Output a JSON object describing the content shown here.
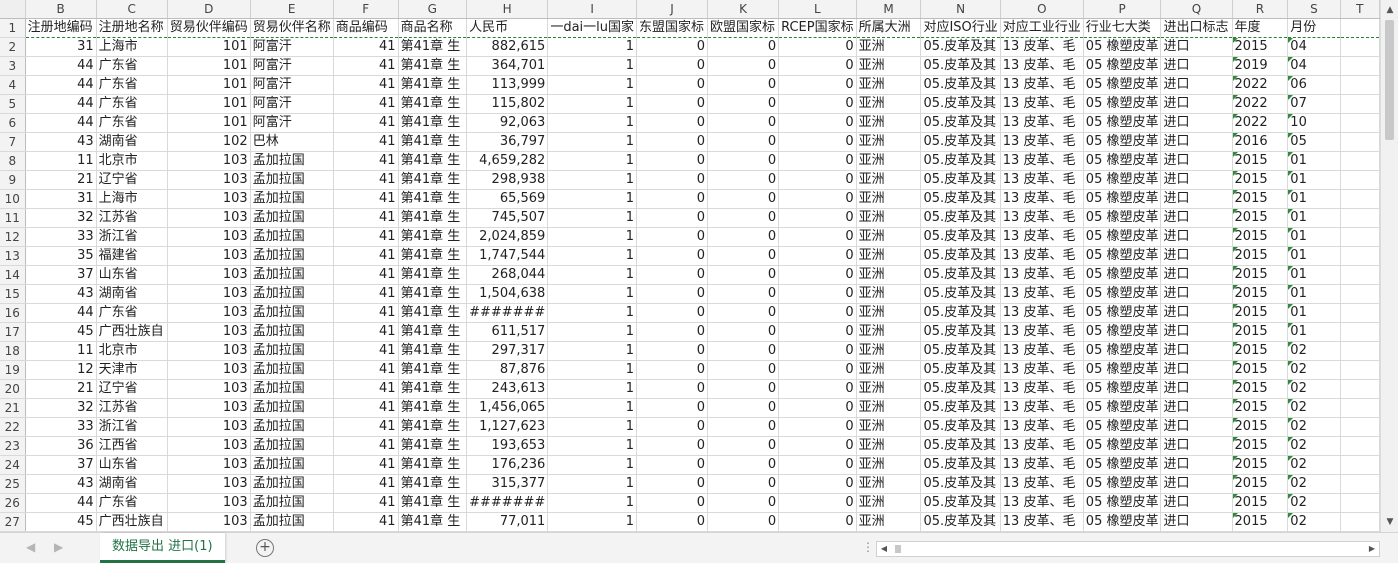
{
  "columns": [
    "B",
    "C",
    "D",
    "E",
    "F",
    "G",
    "H",
    "I",
    "J",
    "K",
    "L",
    "M",
    "N",
    "O",
    "P",
    "Q",
    "R",
    "S",
    "T"
  ],
  "header_row": {
    "number": "1",
    "cells": [
      "注册地编码",
      "注册地名称",
      "贸易伙伴编码",
      "贸易伙伴名称",
      "商品编码",
      "商品名称",
      "人民币",
      "一dai一lu国家",
      "东盟国家标",
      "欧盟国家标",
      "RCEP国家标",
      "所属大洲",
      "对应ISO行业",
      "对应工业行业",
      "行业七大类",
      "进出口标志",
      "年度",
      "月份",
      ""
    ]
  },
  "rows": [
    {
      "n": "2",
      "c": [
        "31",
        "上海市",
        "101",
        "阿富汗",
        "41",
        "第41章 生",
        "882,615",
        "1",
        "0",
        "0",
        "0",
        "亚洲",
        "05.皮革及其",
        "13 皮革、毛",
        "05 橡塑皮革",
        "进口",
        "2015",
        "04",
        ""
      ]
    },
    {
      "n": "3",
      "c": [
        "44",
        "广东省",
        "101",
        "阿富汗",
        "41",
        "第41章 生",
        "364,701",
        "1",
        "0",
        "0",
        "0",
        "亚洲",
        "05.皮革及其",
        "13 皮革、毛",
        "05 橡塑皮革",
        "进口",
        "2019",
        "04",
        ""
      ]
    },
    {
      "n": "4",
      "c": [
        "44",
        "广东省",
        "101",
        "阿富汗",
        "41",
        "第41章 生",
        "113,999",
        "1",
        "0",
        "0",
        "0",
        "亚洲",
        "05.皮革及其",
        "13 皮革、毛",
        "05 橡塑皮革",
        "进口",
        "2022",
        "06",
        ""
      ]
    },
    {
      "n": "5",
      "c": [
        "44",
        "广东省",
        "101",
        "阿富汗",
        "41",
        "第41章 生",
        "115,802",
        "1",
        "0",
        "0",
        "0",
        "亚洲",
        "05.皮革及其",
        "13 皮革、毛",
        "05 橡塑皮革",
        "进口",
        "2022",
        "07",
        ""
      ]
    },
    {
      "n": "6",
      "c": [
        "44",
        "广东省",
        "101",
        "阿富汗",
        "41",
        "第41章 生",
        "92,063",
        "1",
        "0",
        "0",
        "0",
        "亚洲",
        "05.皮革及其",
        "13 皮革、毛",
        "05 橡塑皮革",
        "进口",
        "2022",
        "10",
        ""
      ]
    },
    {
      "n": "7",
      "c": [
        "43",
        "湖南省",
        "102",
        "巴林",
        "41",
        "第41章 生",
        "36,797",
        "1",
        "0",
        "0",
        "0",
        "亚洲",
        "05.皮革及其",
        "13 皮革、毛",
        "05 橡塑皮革",
        "进口",
        "2016",
        "05",
        ""
      ]
    },
    {
      "n": "8",
      "c": [
        "11",
        "北京市",
        "103",
        "孟加拉国",
        "41",
        "第41章 生",
        "4,659,282",
        "1",
        "0",
        "0",
        "0",
        "亚洲",
        "05.皮革及其",
        "13 皮革、毛",
        "05 橡塑皮革",
        "进口",
        "2015",
        "01",
        ""
      ]
    },
    {
      "n": "9",
      "c": [
        "21",
        "辽宁省",
        "103",
        "孟加拉国",
        "41",
        "第41章 生",
        "298,938",
        "1",
        "0",
        "0",
        "0",
        "亚洲",
        "05.皮革及其",
        "13 皮革、毛",
        "05 橡塑皮革",
        "进口",
        "2015",
        "01",
        ""
      ]
    },
    {
      "n": "10",
      "c": [
        "31",
        "上海市",
        "103",
        "孟加拉国",
        "41",
        "第41章 生",
        "65,569",
        "1",
        "0",
        "0",
        "0",
        "亚洲",
        "05.皮革及其",
        "13 皮革、毛",
        "05 橡塑皮革",
        "进口",
        "2015",
        "01",
        ""
      ]
    },
    {
      "n": "11",
      "c": [
        "32",
        "江苏省",
        "103",
        "孟加拉国",
        "41",
        "第41章 生",
        "745,507",
        "1",
        "0",
        "0",
        "0",
        "亚洲",
        "05.皮革及其",
        "13 皮革、毛",
        "05 橡塑皮革",
        "进口",
        "2015",
        "01",
        ""
      ]
    },
    {
      "n": "12",
      "c": [
        "33",
        "浙江省",
        "103",
        "孟加拉国",
        "41",
        "第41章 生",
        "2,024,859",
        "1",
        "0",
        "0",
        "0",
        "亚洲",
        "05.皮革及其",
        "13 皮革、毛",
        "05 橡塑皮革",
        "进口",
        "2015",
        "01",
        ""
      ]
    },
    {
      "n": "13",
      "c": [
        "35",
        "福建省",
        "103",
        "孟加拉国",
        "41",
        "第41章 生",
        "1,747,544",
        "1",
        "0",
        "0",
        "0",
        "亚洲",
        "05.皮革及其",
        "13 皮革、毛",
        "05 橡塑皮革",
        "进口",
        "2015",
        "01",
        ""
      ]
    },
    {
      "n": "14",
      "c": [
        "37",
        "山东省",
        "103",
        "孟加拉国",
        "41",
        "第41章 生",
        "268,044",
        "1",
        "0",
        "0",
        "0",
        "亚洲",
        "05.皮革及其",
        "13 皮革、毛",
        "05 橡塑皮革",
        "进口",
        "2015",
        "01",
        ""
      ]
    },
    {
      "n": "15",
      "c": [
        "43",
        "湖南省",
        "103",
        "孟加拉国",
        "41",
        "第41章 生",
        "1,504,638",
        "1",
        "0",
        "0",
        "0",
        "亚洲",
        "05.皮革及其",
        "13 皮革、毛",
        "05 橡塑皮革",
        "进口",
        "2015",
        "01",
        ""
      ]
    },
    {
      "n": "16",
      "c": [
        "44",
        "广东省",
        "103",
        "孟加拉国",
        "41",
        "第41章 生",
        "#######",
        "1",
        "0",
        "0",
        "0",
        "亚洲",
        "05.皮革及其",
        "13 皮革、毛",
        "05 橡塑皮革",
        "进口",
        "2015",
        "01",
        ""
      ]
    },
    {
      "n": "17",
      "c": [
        "45",
        "广西壮族自",
        "103",
        "孟加拉国",
        "41",
        "第41章 生",
        "611,517",
        "1",
        "0",
        "0",
        "0",
        "亚洲",
        "05.皮革及其",
        "13 皮革、毛",
        "05 橡塑皮革",
        "进口",
        "2015",
        "01",
        ""
      ]
    },
    {
      "n": "18",
      "c": [
        "11",
        "北京市",
        "103",
        "孟加拉国",
        "41",
        "第41章 生",
        "297,317",
        "1",
        "0",
        "0",
        "0",
        "亚洲",
        "05.皮革及其",
        "13 皮革、毛",
        "05 橡塑皮革",
        "进口",
        "2015",
        "02",
        ""
      ]
    },
    {
      "n": "19",
      "c": [
        "12",
        "天津市",
        "103",
        "孟加拉国",
        "41",
        "第41章 生",
        "87,876",
        "1",
        "0",
        "0",
        "0",
        "亚洲",
        "05.皮革及其",
        "13 皮革、毛",
        "05 橡塑皮革",
        "进口",
        "2015",
        "02",
        ""
      ]
    },
    {
      "n": "20",
      "c": [
        "21",
        "辽宁省",
        "103",
        "孟加拉国",
        "41",
        "第41章 生",
        "243,613",
        "1",
        "0",
        "0",
        "0",
        "亚洲",
        "05.皮革及其",
        "13 皮革、毛",
        "05 橡塑皮革",
        "进口",
        "2015",
        "02",
        ""
      ]
    },
    {
      "n": "21",
      "c": [
        "32",
        "江苏省",
        "103",
        "孟加拉国",
        "41",
        "第41章 生",
        "1,456,065",
        "1",
        "0",
        "0",
        "0",
        "亚洲",
        "05.皮革及其",
        "13 皮革、毛",
        "05 橡塑皮革",
        "进口",
        "2015",
        "02",
        ""
      ]
    },
    {
      "n": "22",
      "c": [
        "33",
        "浙江省",
        "103",
        "孟加拉国",
        "41",
        "第41章 生",
        "1,127,623",
        "1",
        "0",
        "0",
        "0",
        "亚洲",
        "05.皮革及其",
        "13 皮革、毛",
        "05 橡塑皮革",
        "进口",
        "2015",
        "02",
        ""
      ]
    },
    {
      "n": "23",
      "c": [
        "36",
        "江西省",
        "103",
        "孟加拉国",
        "41",
        "第41章 生",
        "193,653",
        "1",
        "0",
        "0",
        "0",
        "亚洲",
        "05.皮革及其",
        "13 皮革、毛",
        "05 橡塑皮革",
        "进口",
        "2015",
        "02",
        ""
      ]
    },
    {
      "n": "24",
      "c": [
        "37",
        "山东省",
        "103",
        "孟加拉国",
        "41",
        "第41章 生",
        "176,236",
        "1",
        "0",
        "0",
        "0",
        "亚洲",
        "05.皮革及其",
        "13 皮革、毛",
        "05 橡塑皮革",
        "进口",
        "2015",
        "02",
        ""
      ]
    },
    {
      "n": "25",
      "c": [
        "43",
        "湖南省",
        "103",
        "孟加拉国",
        "41",
        "第41章 生",
        "315,377",
        "1",
        "0",
        "0",
        "0",
        "亚洲",
        "05.皮革及其",
        "13 皮革、毛",
        "05 橡塑皮革",
        "进口",
        "2015",
        "02",
        ""
      ]
    },
    {
      "n": "26",
      "c": [
        "44",
        "广东省",
        "103",
        "孟加拉国",
        "41",
        "第41章 生",
        "#######",
        "1",
        "0",
        "0",
        "0",
        "亚洲",
        "05.皮革及其",
        "13 皮革、毛",
        "05 橡塑皮革",
        "进口",
        "2015",
        "02",
        ""
      ]
    },
    {
      "n": "27",
      "c": [
        "45",
        "广西壮族自",
        "103",
        "孟加拉国",
        "41",
        "第41章 生",
        "77,011",
        "1",
        "0",
        "0",
        "0",
        "亚洲",
        "05.皮革及其",
        "13 皮革、毛",
        "05 橡塑皮革",
        "进口",
        "2015",
        "02",
        ""
      ]
    }
  ],
  "sheet_tab": "数据导出 进口(1)",
  "add_sheet_label": "+",
  "colors": {
    "accent": "#217346",
    "flag": "#2e8b3c",
    "dashed_border": "#2e7d32"
  }
}
